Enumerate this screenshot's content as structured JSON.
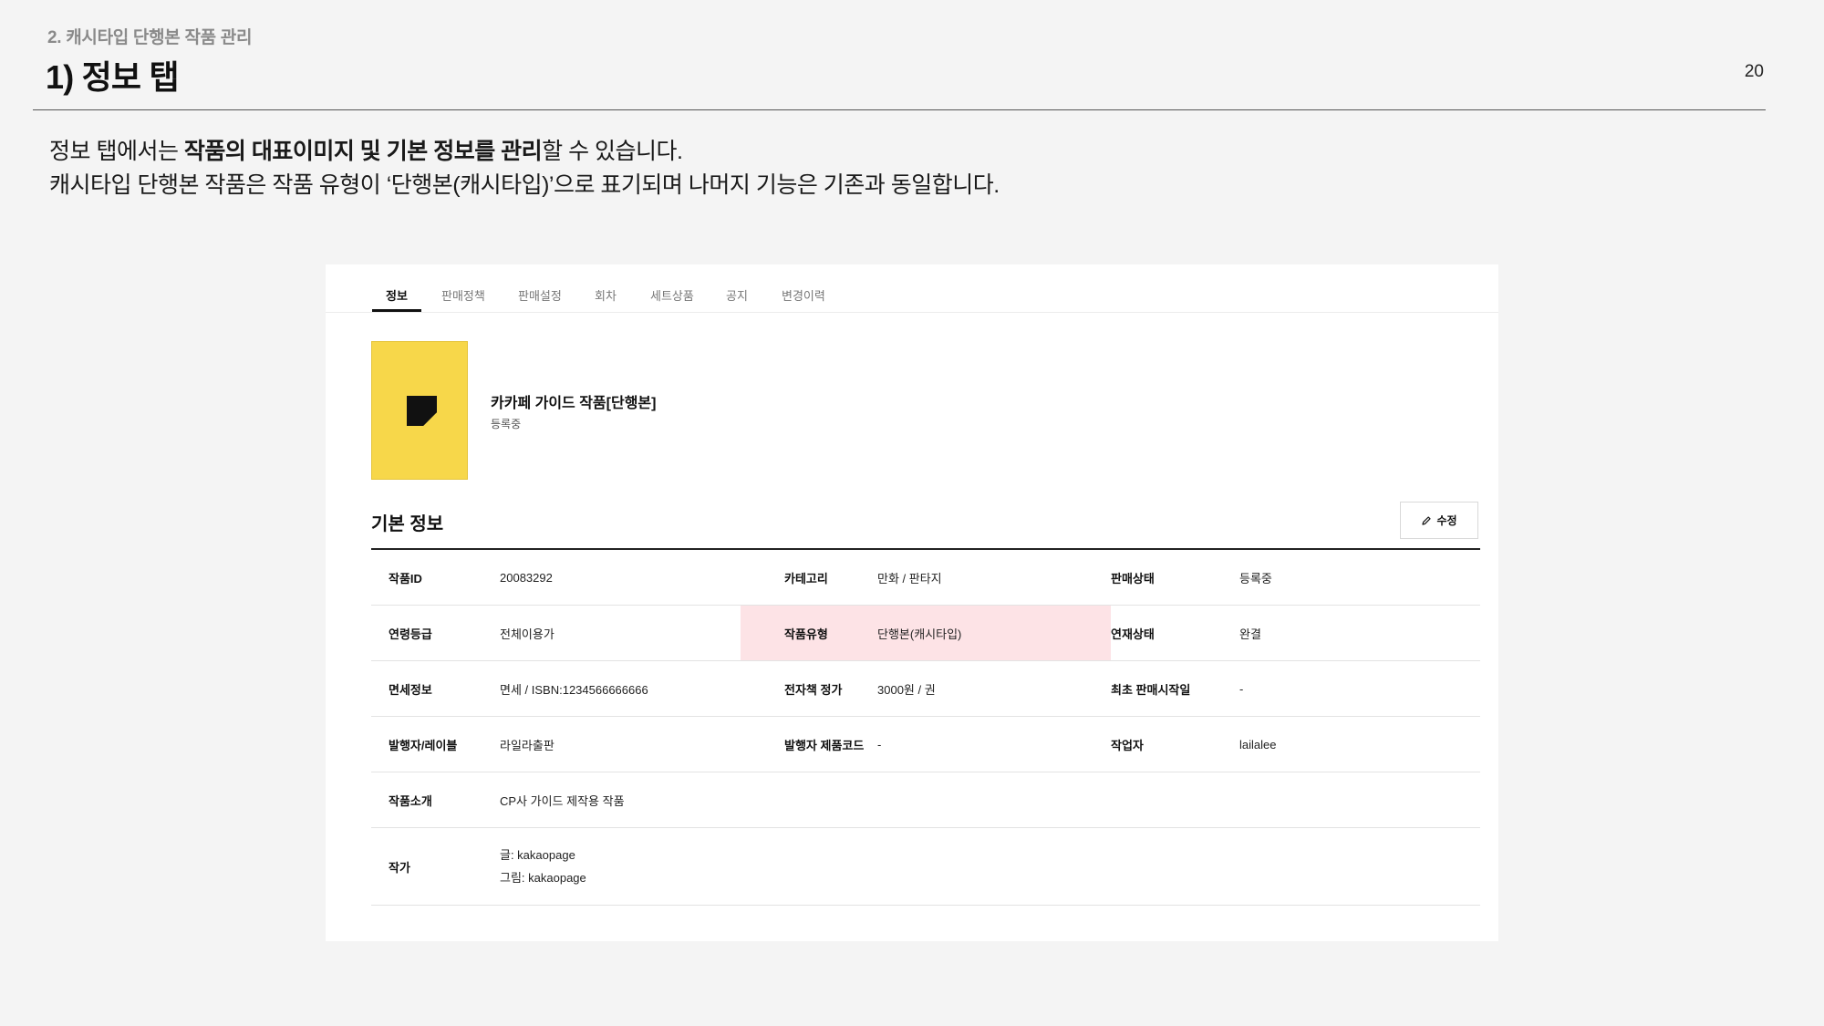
{
  "slide": {
    "section_label": "2. 캐시타입 단행본 작품 관리",
    "title": "1) 정보 탭",
    "page_number": "20",
    "desc_line1_a": "정보 탭에서는 ",
    "desc_line1_bold": "작품의 대표이미지 및 기본 정보를 관리",
    "desc_line1_b": "할 수 있습니다.",
    "desc_line2": "캐시타입 단행본 작품은 작품 유형이 ‘단행본(캐시타입)’으로 표기되며 나머지 기능은 기존과 동일합니다."
  },
  "tabs": [
    {
      "label": "정보",
      "active": true
    },
    {
      "label": "판매정책"
    },
    {
      "label": "판매설정"
    },
    {
      "label": "회차"
    },
    {
      "label": "세트상품"
    },
    {
      "label": "공지"
    },
    {
      "label": "변경이력"
    }
  ],
  "work": {
    "title": "카카페 가이드 작품[단행본]",
    "status": "등록중",
    "cover_color": "#f7d74a"
  },
  "basic_info": {
    "title": "기본 정보",
    "edit_label": "수정",
    "edit_icon": "pencil-icon",
    "highlight_color": "#fde3e6",
    "rows": [
      [
        {
          "label": "작품ID",
          "value": "20083292"
        },
        {
          "label": "카테고리",
          "value": "만화 / 판타지"
        },
        {
          "label": "판매상태",
          "value": "등록중"
        }
      ],
      [
        {
          "label": "연령등급",
          "value": "전체이용가"
        },
        {
          "label": "작품유형",
          "value": "단행본(캐시타입)"
        },
        {
          "label": "연재상태",
          "value": "완결"
        }
      ],
      [
        {
          "label": "면세정보",
          "value": "면세 / ISBN:1234566666666"
        },
        {
          "label": "전자책 정가",
          "value": "3000원 / 권"
        },
        {
          "label": "최초 판매시작일",
          "value": "-"
        }
      ],
      [
        {
          "label": "발행자/레이블",
          "value": "라일라출판"
        },
        {
          "label": "발행자 제품코드",
          "value": "-"
        },
        {
          "label": "작업자",
          "value": "lailalee"
        }
      ],
      [
        {
          "label": "작품소개",
          "value": "CP사 가이드 제작용 작품"
        }
      ],
      [
        {
          "label": "작가",
          "value_lines": [
            "글: kakaopage",
            "그림: kakaopage"
          ]
        }
      ]
    ]
  }
}
